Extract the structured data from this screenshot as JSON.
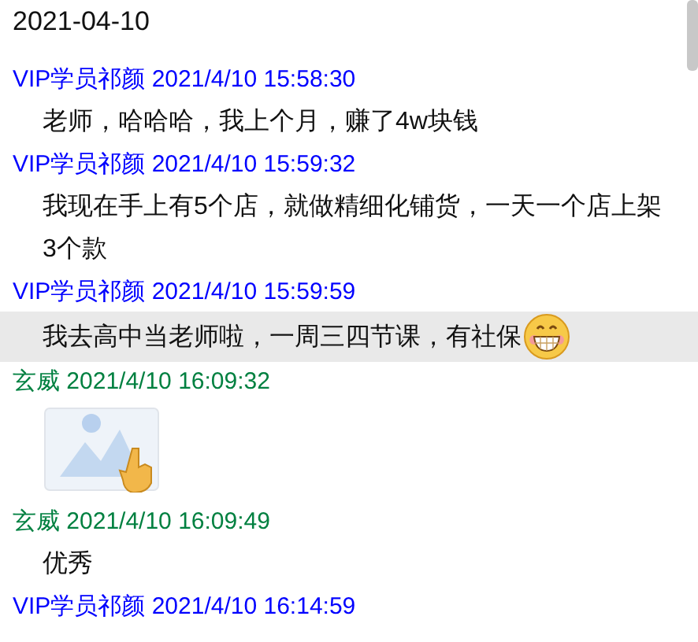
{
  "date": "2021-04-10",
  "messages": [
    {
      "sender": "VIP学员祁颜",
      "time": "2021/4/10 15:58:30",
      "color": "#0000ff",
      "kind": "text",
      "text": "老师，哈哈哈，我上个月，赚了4w块钱",
      "selected": false
    },
    {
      "sender": "VIP学员祁颜",
      "time": "2021/4/10 15:59:32",
      "color": "#0000ff",
      "kind": "text",
      "text": "我现在手上有5个店，就做精细化铺货，一天一个店上架3个款",
      "selected": false
    },
    {
      "sender": "VIP学员祁颜",
      "time": "2021/4/10 15:59:59",
      "color": "#0000ff",
      "kind": "text",
      "text": "我去高中当老师啦，一周三四节课，有社保",
      "selected": true,
      "emoji": true
    },
    {
      "sender": "玄威",
      "time": "2021/4/10 16:09:32",
      "color": "#008040",
      "kind": "image",
      "selected": false
    },
    {
      "sender": "玄威",
      "time": "2021/4/10 16:09:49",
      "color": "#008040",
      "kind": "text",
      "text": "优秀",
      "selected": false
    },
    {
      "sender": "VIP学员祁颜",
      "time": "2021/4/10 16:14:59",
      "color": "#0000ff",
      "kind": "header-only",
      "selected": false
    }
  ]
}
